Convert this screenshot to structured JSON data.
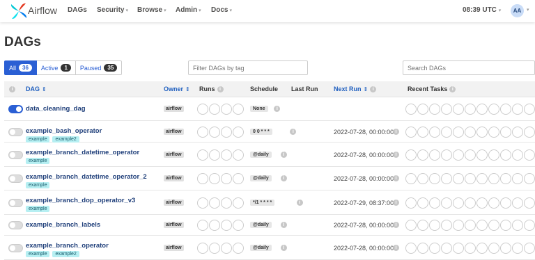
{
  "navbar": {
    "brand": "Airflow",
    "items": [
      {
        "label": "DAGs",
        "caret": ""
      },
      {
        "label": "Security",
        "caret": "▾"
      },
      {
        "label": "Browse",
        "caret": "▾"
      },
      {
        "label": "Admin",
        "caret": "▾"
      },
      {
        "label": "Docs",
        "caret": "▾"
      }
    ],
    "clock": "08:39 UTC",
    "clock_caret": "▾",
    "user_initials": "AA",
    "user_caret": "▾"
  },
  "page": {
    "title": "DAGs"
  },
  "filters": {
    "all": {
      "label": "All",
      "count": "36"
    },
    "active": {
      "label": "Active",
      "count": "1"
    },
    "paused": {
      "label": "Paused",
      "count": "35"
    },
    "tag_placeholder": "Filter DAGs by tag",
    "search_placeholder": "Search DAGs"
  },
  "table": {
    "headers": {
      "info": "i",
      "dag": "DAG",
      "sort_icon": "⇕",
      "owner": "Owner",
      "runs": "Runs",
      "schedule": "Schedule",
      "last_run": "Last Run",
      "next_run": "Next Run",
      "recent_tasks": "Recent Tasks"
    },
    "rows": [
      {
        "name": "data_cleaning_dag",
        "tags": [],
        "owner": "airflow",
        "schedule": "None",
        "next_run": "",
        "active": true
      },
      {
        "name": "example_bash_operator",
        "tags": [
          "example",
          "example2"
        ],
        "owner": "airflow",
        "schedule": "0 0 * * *",
        "next_run": "2022-07-28, 00:00:00",
        "active": false
      },
      {
        "name": "example_branch_datetime_operator",
        "tags": [
          "example"
        ],
        "owner": "airflow",
        "schedule": "@daily",
        "next_run": "2022-07-28, 00:00:00",
        "active": false
      },
      {
        "name": "example_branch_datetime_operator_2",
        "tags": [
          "example"
        ],
        "owner": "airflow",
        "schedule": "@daily",
        "next_run": "2022-07-28, 00:00:00",
        "active": false
      },
      {
        "name": "example_branch_dop_operator_v3",
        "tags": [
          "example"
        ],
        "owner": "airflow",
        "schedule": "*/1 * * * *",
        "next_run": "2022-07-29, 08:37:00",
        "active": false
      },
      {
        "name": "example_branch_labels",
        "tags": [],
        "owner": "airflow",
        "schedule": "@daily",
        "next_run": "2022-07-28, 00:00:00",
        "active": false
      },
      {
        "name": "example_branch_operator",
        "tags": [
          "example",
          "example2"
        ],
        "owner": "airflow",
        "schedule": "@daily",
        "next_run": "2022-07-28, 00:00:00",
        "active": false
      }
    ]
  },
  "colors": {
    "accent": "#2a5fd4",
    "tag_bg": "#b6eff2",
    "link": "#1f3f7a"
  }
}
